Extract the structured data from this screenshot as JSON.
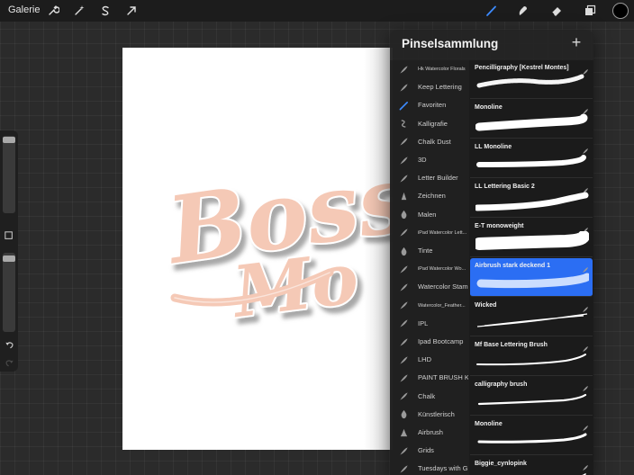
{
  "topbar": {
    "gallery_label": "Galerie",
    "colors": {
      "active_tool": "#3d8bff",
      "selected_color": "#000000"
    }
  },
  "panel": {
    "title": "Pinselsammlung",
    "add_label": "+",
    "sets": [
      {
        "label": "Hk Watercolor Florals",
        "icon": "feather-icon",
        "small": true
      },
      {
        "label": "Keep Lettering",
        "icon": "feather-icon",
        "small": false
      },
      {
        "label": "Favoriten",
        "icon": "brush-icon",
        "small": false,
        "active": true
      },
      {
        "label": "Kalligrafie",
        "icon": "calligraphy-icon",
        "small": false
      },
      {
        "label": "Chalk Dust",
        "icon": "feather-icon",
        "small": false
      },
      {
        "label": "3D",
        "icon": "feather-icon",
        "small": false
      },
      {
        "label": "Letter Builder",
        "icon": "feather-icon",
        "small": false
      },
      {
        "label": "Zeichnen",
        "icon": "pencil-tip-icon",
        "small": false
      },
      {
        "label": "Malen",
        "icon": "drop-icon",
        "small": false
      },
      {
        "label": "iPad Watercolor Lett...",
        "icon": "feather-icon",
        "small": true
      },
      {
        "label": "Tinte",
        "icon": "drop-icon",
        "small": false
      },
      {
        "label": "iPad Watercolor Wo...",
        "icon": "feather-icon",
        "small": true
      },
      {
        "label": "Watercolor Stamps",
        "icon": "feather-icon",
        "small": false
      },
      {
        "label": "Watercolor_Feather...",
        "icon": "feather-icon",
        "small": true
      },
      {
        "label": "IPL",
        "icon": "feather-icon",
        "small": false
      },
      {
        "label": "Ipad Bootcamp",
        "icon": "feather-icon",
        "small": false
      },
      {
        "label": "LHD",
        "icon": "feather-icon",
        "small": false
      },
      {
        "label": "PAINT BRUSH KIT",
        "icon": "feather-icon",
        "small": false
      },
      {
        "label": "Chalk",
        "icon": "feather-icon",
        "small": false
      },
      {
        "label": "Künstlerisch",
        "icon": "drop-icon",
        "small": false
      },
      {
        "label": "Airbrush",
        "icon": "airbrush-icon",
        "small": false
      },
      {
        "label": "Grids",
        "icon": "feather-icon",
        "small": false
      },
      {
        "label": "Tuesdays with G",
        "icon": "feather-icon",
        "small": false
      }
    ],
    "brushes": [
      {
        "name": "Pencilligraphy [Kestrel Montes]",
        "stroke": "rough"
      },
      {
        "name": "Monoline",
        "stroke": "thick"
      },
      {
        "name": "LL Monoline",
        "stroke": "medium"
      },
      {
        "name": "LL Lettering Basic 2",
        "stroke": "taper"
      },
      {
        "name": "E-T monoweight",
        "stroke": "bold"
      },
      {
        "name": "Airbrush stark deckend 1",
        "stroke": "soft",
        "selected": true
      },
      {
        "name": "Wicked",
        "stroke": "wicked"
      },
      {
        "name": "Mf Base Lettering Brush",
        "stroke": "thin"
      },
      {
        "name": "calligraphy brush",
        "stroke": "thin2"
      },
      {
        "name": "Monoline",
        "stroke": "mono2"
      },
      {
        "name": "Biggie_cynlopink",
        "stroke": "thin3"
      }
    ]
  },
  "canvas": {
    "lettering": "Boss Mo",
    "colors": {
      "fill": "#f5c9b6",
      "outline": "#ffffff",
      "shadow": "#9a9a9a"
    }
  }
}
